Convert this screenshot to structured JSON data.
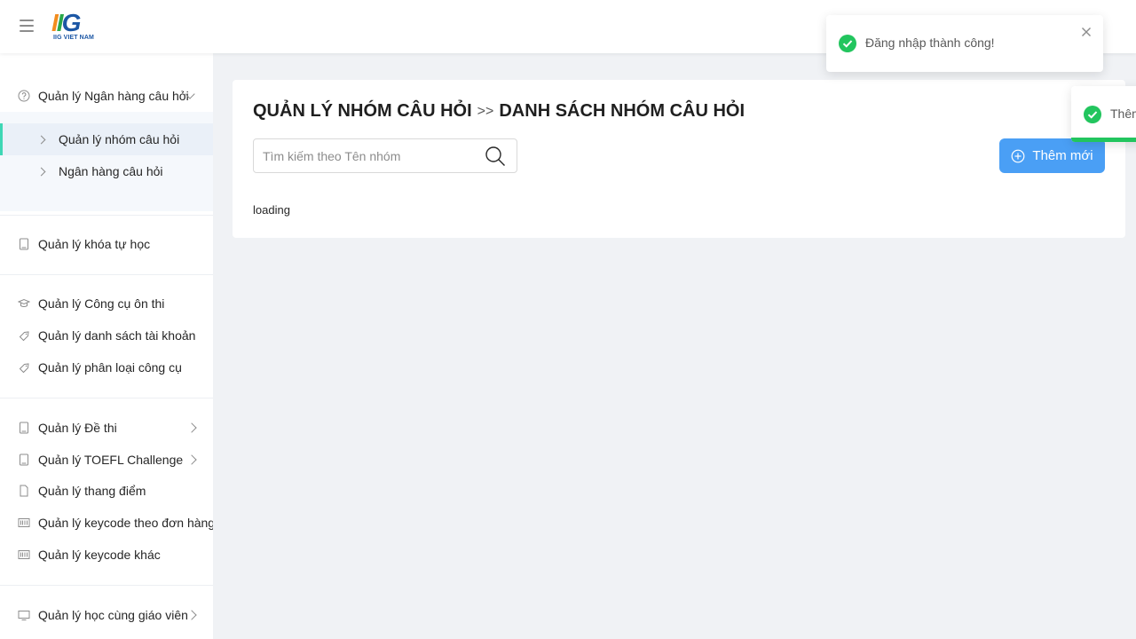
{
  "header": {
    "logo_mark": "IIG",
    "logo_sub": "IIG VIET NAM"
  },
  "sidebar": {
    "group_question_bank": {
      "label": "Quản lý Ngân hàng câu hỏi",
      "icon": "question-circle-icon",
      "children": [
        {
          "label": "Quản lý nhóm câu hỏi",
          "active": true
        },
        {
          "label": "Ngân hàng câu hỏi",
          "active": false
        }
      ]
    },
    "items": [
      {
        "label": "Quản lý khóa tự học",
        "icon": "book-icon"
      },
      {
        "label": "Quản lý Công cụ ôn thi",
        "icon": "graduation-cap-icon"
      },
      {
        "label": "Quản lý danh sách tài khoản",
        "icon": "tag-icon"
      },
      {
        "label": "Quản lý phân loại công cụ",
        "icon": "tag-icon"
      },
      {
        "label": "Quản lý Đề thi",
        "icon": "book-icon"
      },
      {
        "label": "Quản lý TOEFL Challenge",
        "icon": "book-icon"
      },
      {
        "label": "Quản lý thang điểm",
        "icon": "file-icon"
      },
      {
        "label": "Quản lý keycode theo đơn hàng",
        "icon": "barcode-icon"
      },
      {
        "label": "Quản lý keycode khác",
        "icon": "barcode-icon"
      },
      {
        "label": "Quản lý học cùng giáo viên",
        "icon": "monitor-icon"
      }
    ]
  },
  "main": {
    "breadcrumb_parent": "QUẢN LÝ NHÓM CÂU HỎI",
    "breadcrumb_sep": ">>",
    "breadcrumb_current": "DANH SÁCH NHÓM CÂU HỎI",
    "search_placeholder": "Tìm kiếm theo Tên nhóm",
    "search_value": "",
    "add_button": "Thêm mới",
    "loading_text": "loading"
  },
  "toasts": {
    "login_success": "Đăng nhập thành công!",
    "second_partial": "Thêm"
  },
  "colors": {
    "accent": "#4a9ff5",
    "active_indicator": "#3ed7b5",
    "success": "#22c55e"
  }
}
